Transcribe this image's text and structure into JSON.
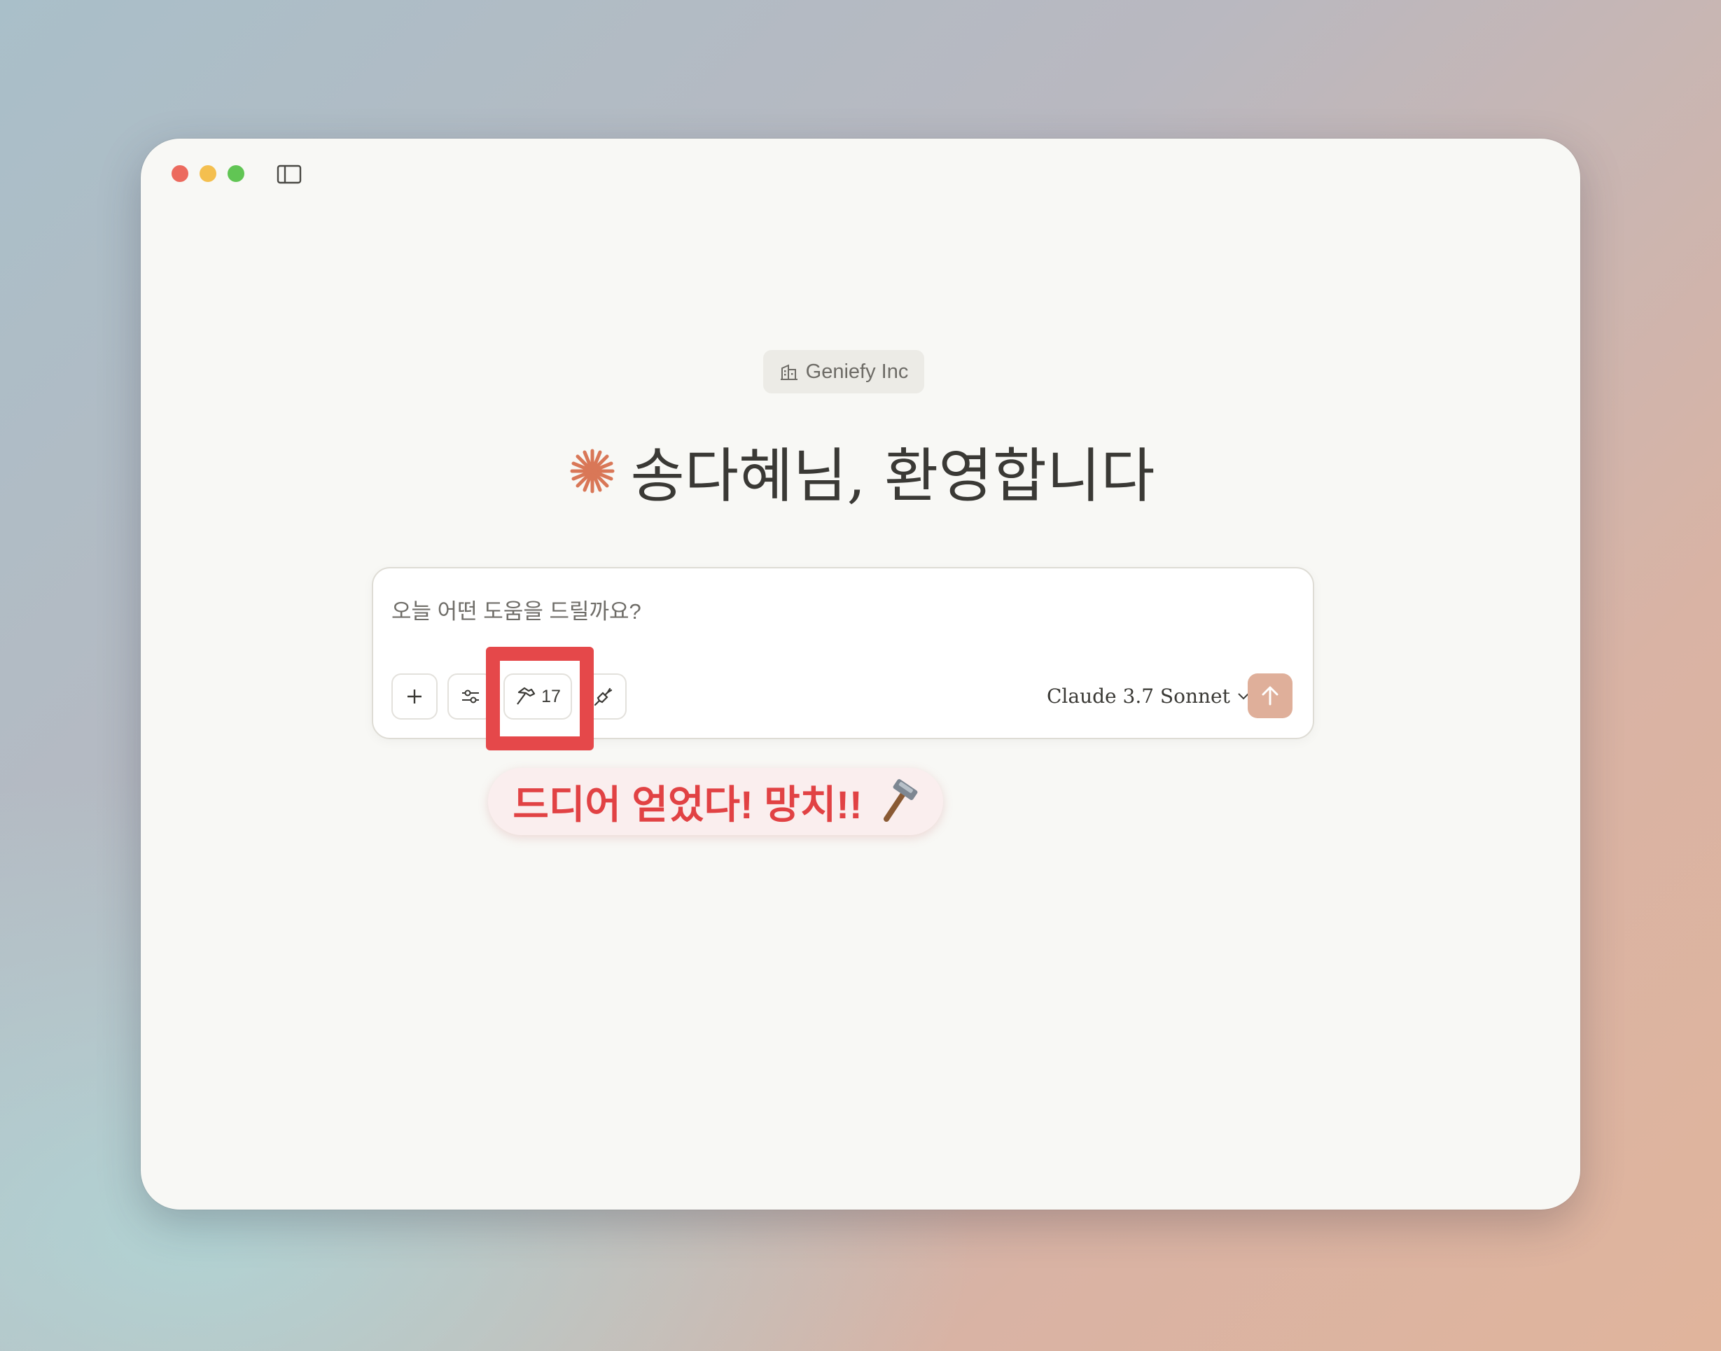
{
  "window": {
    "sidebar_toggle_icon": "sidebar-toggle-icon"
  },
  "org_badge": {
    "icon": "building-icon",
    "label": "Geniefy Inc"
  },
  "greeting": {
    "icon": "claude-spark-icon",
    "text": "송다혜님, 환영합니다",
    "accent_color": "#d97757"
  },
  "composer": {
    "placeholder": "오늘 어떤 도움을 드릴까요?",
    "buttons": {
      "add_icon": "plus-icon",
      "settings_icon": "sliders-icon",
      "tools_icon": "hammer-icon",
      "tools_count": "17",
      "integrations_icon": "plug-icon"
    },
    "model": "Claude 3.7 Sonnet",
    "send_icon": "arrow-up-icon",
    "send_color": "#dfaf9a"
  },
  "annotation": {
    "text": "드디어 얻었다! 망치!!",
    "emoji_icon": "hammer-emoji-icon",
    "color": "#e5484a"
  }
}
